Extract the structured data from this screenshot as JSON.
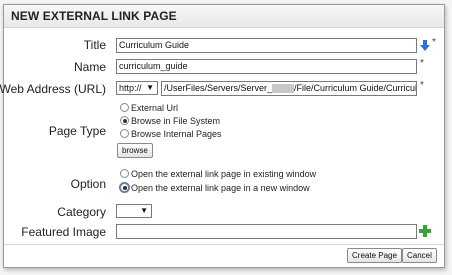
{
  "dialog": {
    "title": "NEW EXTERNAL LINK PAGE"
  },
  "required_marker": "*",
  "fields": {
    "title": {
      "label": "Title",
      "value": "Curriculum Guide"
    },
    "name": {
      "label": "Name",
      "value": "curriculum_guide"
    },
    "url": {
      "label": "Web Address (URL)",
      "protocol": "http://",
      "path_start": "/UserFiles/Servers/Server_",
      "path_end": "/File/Curriculum Guide/Curricul"
    },
    "page_type": {
      "label": "Page Type",
      "options": [
        "External Url",
        "Browse in File System",
        "Browse Internal Pages"
      ],
      "selected": "Browse in File System",
      "browse_label": "browse"
    },
    "option": {
      "label": "Option",
      "options": [
        "Open the external link page in existing window",
        "Open the external link page in a new window"
      ],
      "selected": "Open the external link page in a new window"
    },
    "category": {
      "label": "Category",
      "value": ""
    },
    "featured_image": {
      "label": "Featured Image",
      "value": ""
    }
  },
  "buttons": {
    "create": "Create Page",
    "cancel": "Cancel"
  },
  "colors": {
    "accent_icon": "#2f6fd6",
    "add_icon": "#36a33a"
  },
  "icons": {
    "title_action": "arrow-down-icon",
    "featured_add": "plus-icon"
  }
}
